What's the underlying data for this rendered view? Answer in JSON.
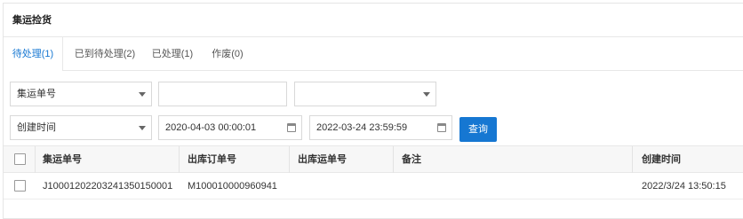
{
  "panel": {
    "title": "集运捡货"
  },
  "tabs": [
    {
      "label": "待处理(1)",
      "active": true
    },
    {
      "label": "已到待处理(2)",
      "active": false
    },
    {
      "label": "已处理(1)",
      "active": false
    },
    {
      "label": "作废(0)",
      "active": false
    }
  ],
  "filters": {
    "search_type": "集运单号",
    "search_value": "",
    "extra_select": "",
    "date_type": "创建时间",
    "start_date": "2020-04-03 00:00:01",
    "end_date": "2022-03-24 23:59:59",
    "query_label": "查询"
  },
  "table": {
    "headers": {
      "consolidation_no": "集运单号",
      "outbound_order_no": "出库订单号",
      "outbound_waybill_no": "出库运单号",
      "remark": "备注",
      "created_at": "创建时间"
    },
    "rows": [
      {
        "consolidation_no": "J1000120220324135015000​1",
        "outbound_order_no": "M100010000960941",
        "outbound_waybill_no": "",
        "remark": "",
        "created_at": "2022/3/24 13:50:15"
      }
    ]
  },
  "colors": {
    "accent": "#1677d2"
  }
}
